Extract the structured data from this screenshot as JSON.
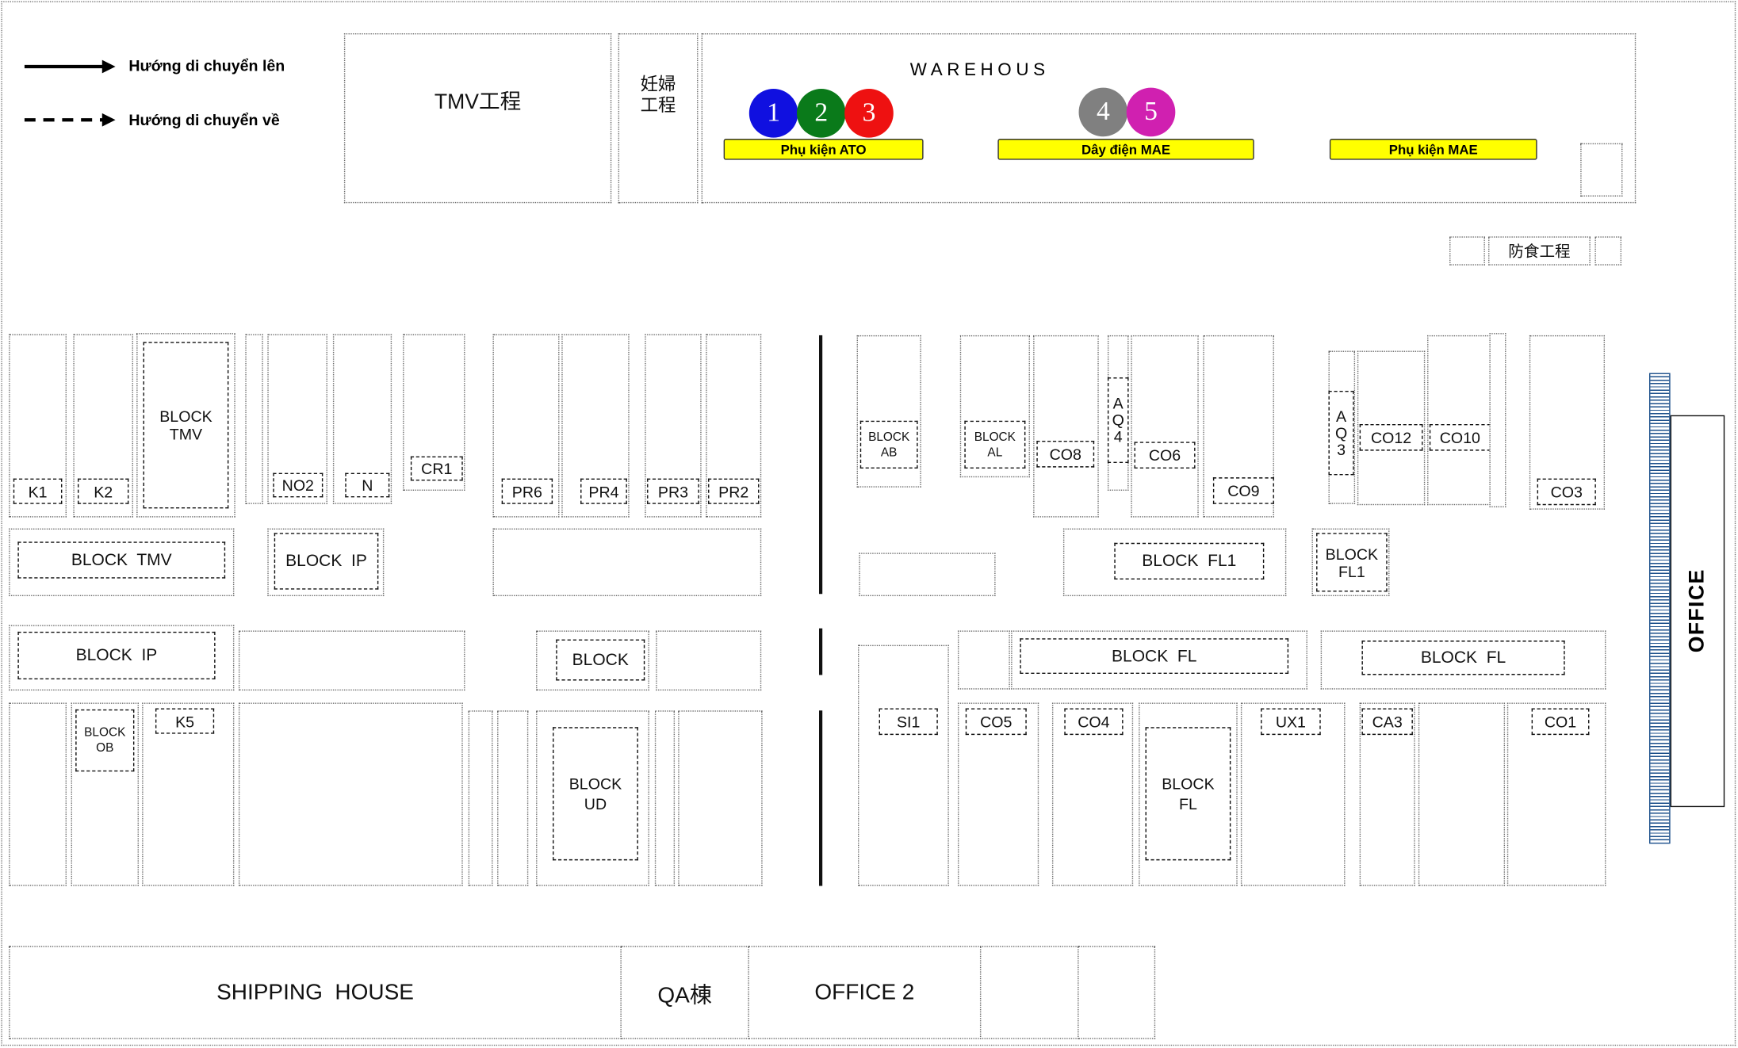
{
  "legend": {
    "up": "Hướng di chuyển lên",
    "back": "Hướng di chuyển về"
  },
  "top": {
    "tmv": "TMV工程",
    "maternity": "妊婦\n工程",
    "warehouse": "WAREHOUS",
    "anticorrosion": "防食工程"
  },
  "markers": [
    {
      "num": "1",
      "color": "#1010e0"
    },
    {
      "num": "2",
      "color": "#0a7a1a"
    },
    {
      "num": "3",
      "color": "#ee1111"
    },
    {
      "num": "4",
      "color": "#808080"
    },
    {
      "num": "5",
      "color": "#d020b0"
    }
  ],
  "bands": {
    "ato": "Phụ kiện ATO",
    "mae_wire": "Dây điện MAE",
    "mae_acc": "Phụ kiện MAE",
    "color": "#ffff00"
  },
  "labels": {
    "k1": "K1",
    "k2": "K2",
    "block_tmv_v": "BLOCK\nTMV",
    "no2": "NO2",
    "n": "N",
    "cr1": "CR1",
    "pr6": "PR6",
    "pr4": "PR4",
    "pr3": "PR3",
    "pr2": "PR2",
    "block_ab": "BLOCK\nAB",
    "block_al": "BLOCK\nAL",
    "co8": "CO8",
    "aq4": "A\nQ\n4",
    "co6": "CO6",
    "co9": "CO9",
    "aq3": "A\nQ\n3",
    "co12": "CO12",
    "co10": "CO10",
    "co3": "CO3",
    "block_tmv_h": "BLOCK  TMV",
    "block_ip_1": "BLOCK  IP",
    "block_fl1_a": "BLOCK  FL1",
    "block_fl1_b": "BLOCK\nFL1",
    "block_ip_2": "BLOCK  IP",
    "block": "BLOCK",
    "block_fl_a": "BLOCK  FL",
    "block_fl_b": "BLOCK  FL",
    "block_ob": "BLOCK\nOB",
    "k5": "K5",
    "block_ud": "BLOCK\nUD",
    "si1": "SI1",
    "co5": "CO5",
    "co4": "CO4",
    "block_fl_v": "BLOCK\nFL",
    "ux1": "UX1",
    "ca3": "CA3",
    "co1": "CO1"
  },
  "bottom": {
    "shipping": "SHIPPING  HOUSE",
    "qa": "QA棟",
    "office2": "OFFICE 2"
  },
  "office": "OFFICE"
}
